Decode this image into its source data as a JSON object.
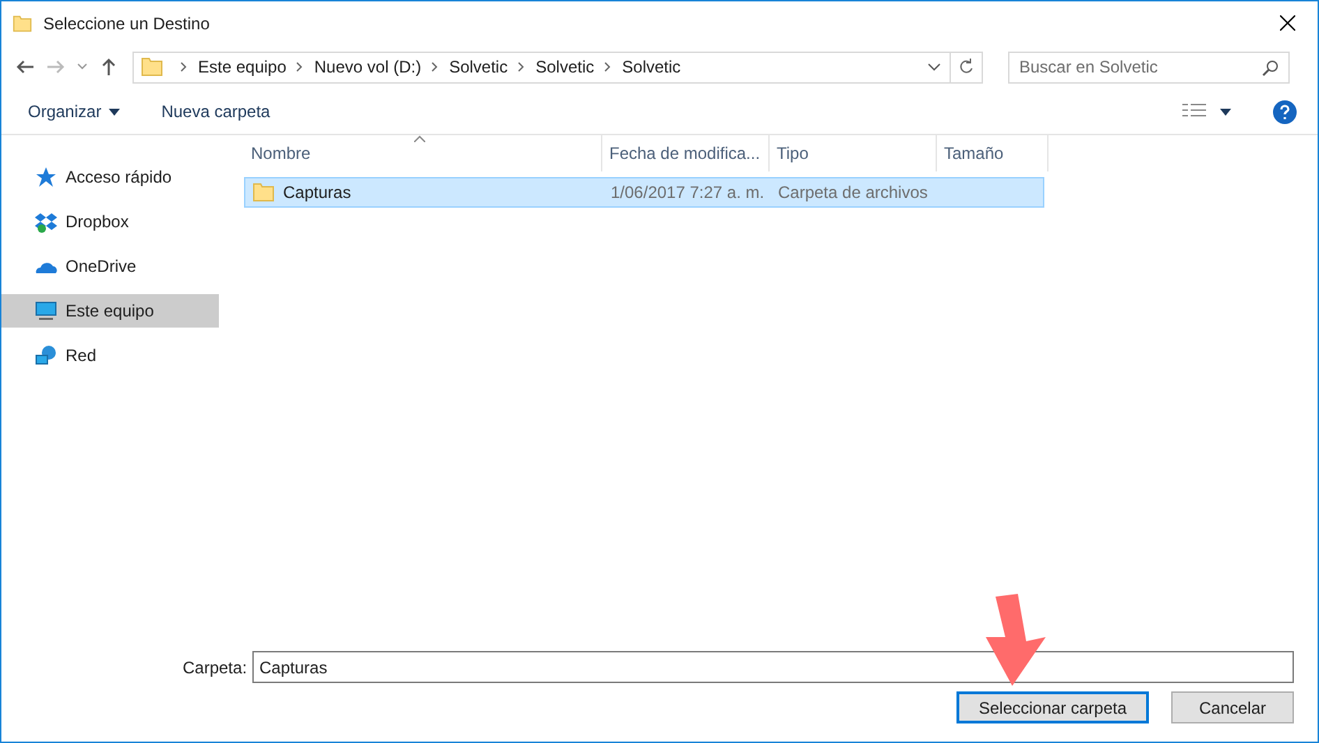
{
  "window": {
    "title": "Seleccione un Destino"
  },
  "breadcrumb": [
    "Este equipo",
    "Nuevo vol (D:)",
    "Solvetic",
    "Solvetic",
    "Solvetic"
  ],
  "search": {
    "placeholder": "Buscar en Solvetic"
  },
  "toolbar": {
    "organize": "Organizar",
    "new_folder": "Nueva carpeta"
  },
  "sidebar": {
    "items": [
      {
        "label": "Acceso rápido",
        "kind": "star",
        "selected": false
      },
      {
        "label": "Dropbox",
        "kind": "dropbox",
        "selected": false
      },
      {
        "label": "OneDrive",
        "kind": "cloud",
        "selected": false
      },
      {
        "label": "Este equipo",
        "kind": "pc",
        "selected": true
      },
      {
        "label": "Red",
        "kind": "network",
        "selected": false
      }
    ]
  },
  "table": {
    "columns": [
      "Nombre",
      "Fecha de modifica...",
      "Tipo",
      "Tamaño"
    ],
    "rows": [
      {
        "name": "Capturas",
        "date": "1/06/2017 7:27 a. m.",
        "type": "Carpeta de archivos",
        "selected": true
      }
    ]
  },
  "folder_field": {
    "label": "Carpeta:",
    "value": "Capturas"
  },
  "buttons": [
    {
      "label": "Seleccionar carpeta",
      "kind": "primary"
    },
    {
      "label": "Cancelar",
      "kind": "secondary"
    }
  ]
}
